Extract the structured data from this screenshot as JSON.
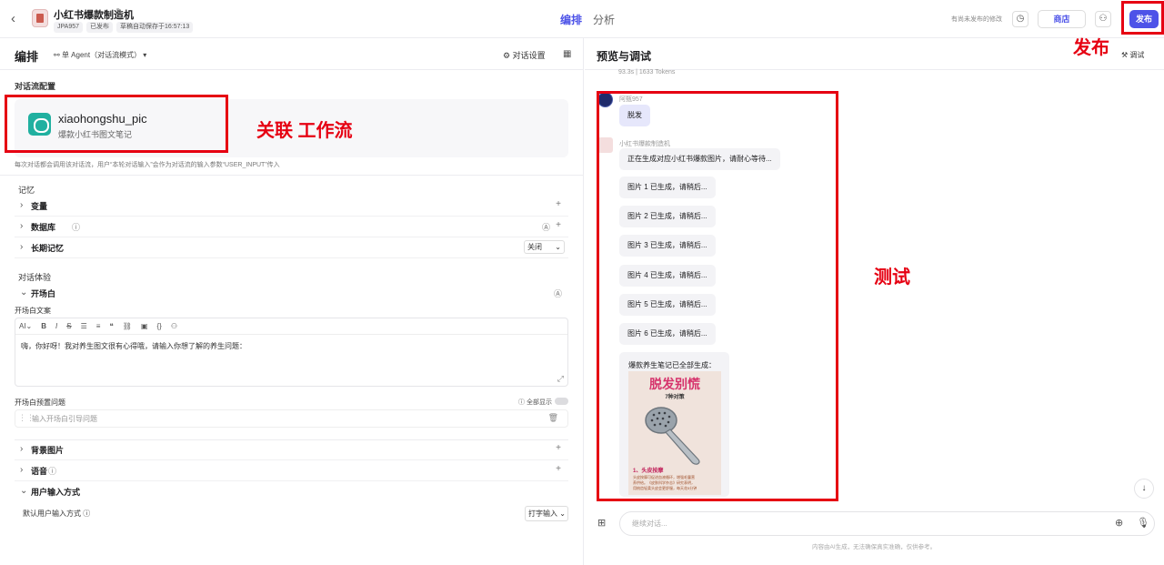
{
  "header": {
    "app_title": "小红书爆款制造机",
    "meta_user": "JPA957",
    "meta_status": "已发布",
    "meta_autosave": "草稿自动保存于16:57:13",
    "tab_edit": "编排",
    "tab_analysis": "分析",
    "unpublished_note": "有尚未发布的修改",
    "store_label": "商店",
    "publish_label": "发布"
  },
  "annotations": {
    "publish": "发布",
    "link_workflow": "关联 工作流",
    "test": "测试"
  },
  "left": {
    "title": "编排",
    "agent_mode": "单 Agent（对话流模式）",
    "chat_settings": "对话设置",
    "flow_config_label": "对话流配置",
    "workflow": {
      "name": "xiaohongshu_pic",
      "desc": "爆款小红书图文笔记"
    },
    "hint": "每次对话都会调用该对话流，用户“本轮对话输入”会作为对话流的输入参数“USER_INPUT”传入",
    "memory_label": "记忆",
    "rows_memory": [
      {
        "label": "变量"
      },
      {
        "label": "数据库"
      },
      {
        "label": "长期记忆",
        "value": "关闭"
      }
    ],
    "experience_label": "对话体验",
    "opening_label": "开场白",
    "opening_copy_label": "开场白文案",
    "opening_text": "嗨，你好呀！我对养生图文很有心得哦，请输入你想了解的养生问题：",
    "preset_label": "开场白预置问题",
    "show_all": "全部显示",
    "preset_placeholder": "输入开场白引导问题",
    "rows_more": [
      {
        "label": "背景图片"
      },
      {
        "label": "语音"
      },
      {
        "label": "用户输入方式"
      }
    ],
    "default_input_label": "默认用户输入方式",
    "default_input_value": "打字输入"
  },
  "right": {
    "title": "预览与调试",
    "debug_label": "调试",
    "tokens": "93.3s | 1633 Tokens",
    "user_name": "阿甄957",
    "user_msg": "脱发",
    "bot_name": "小红书爆款制造机",
    "bot_msgs": [
      "正在生成对应小红书爆款图片，请耐心等待...",
      "图片 1 已生成，请稍后...",
      "图片 2 已生成，请稍后...",
      "图片 3 已生成，请稍后...",
      "图片 4 已生成，请稍后...",
      "图片 5 已生成，请稍后...",
      "图片 6 已生成，请稍后..."
    ],
    "final_msg": "爆款养生笔记已全部生成：",
    "poster": {
      "title": "脱发别慌",
      "subtitle": "7种对策",
      "section": "1、头皮按摩",
      "lines": [
        "头皮按摩可促进血液循环，增强毛囊营",
        "养供给。《皮肤科学杂志》研究表明，",
        "用梳齿轻柔头皮会更舒服，每天花5分钟"
      ]
    },
    "input_placeholder": "继续对话...",
    "disclaimer": "内容由AI生成，无法确保真实准确，仅供参考。"
  },
  "colors": {
    "accent": "#4d53e8",
    "annotation_red": "#e60012"
  }
}
